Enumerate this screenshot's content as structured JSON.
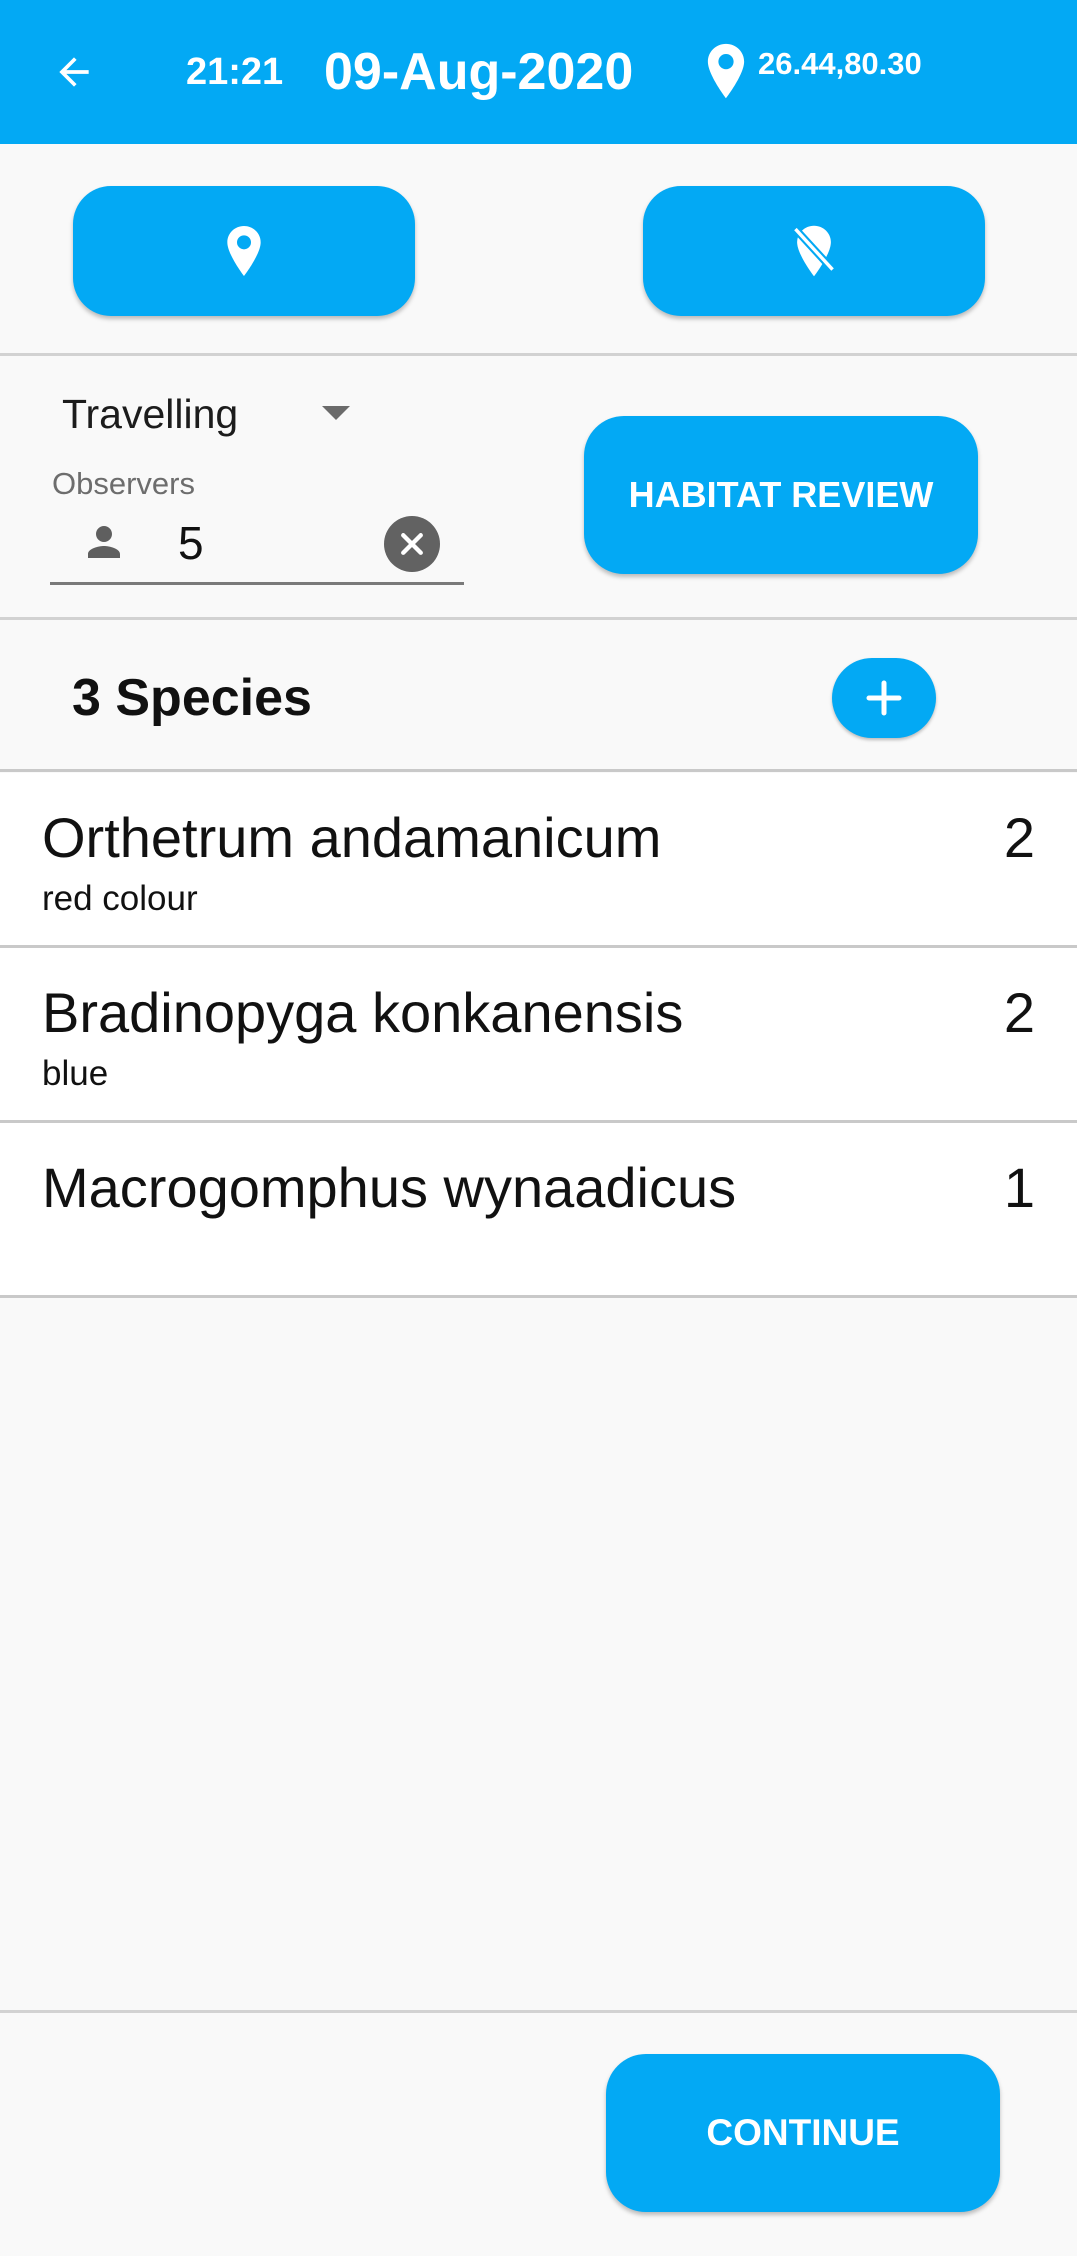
{
  "header": {
    "time": "21:21",
    "date": "09-Aug-2020",
    "coords": "26.44,80.30",
    "back_icon": "arrow-left-icon",
    "location_icon": "map-pin-icon",
    "color": "#03a9f4"
  },
  "location_buttons": {
    "set_icon": "map-pin-icon",
    "clear_icon": "map-pin-off-icon"
  },
  "survey": {
    "mode": "Travelling",
    "observers_label": "Observers",
    "observers_value": "5",
    "habitat_label": "HABITAT REVIEW"
  },
  "species_header": {
    "count_label": "3 Species",
    "add_icon": "plus-icon"
  },
  "species": [
    {
      "name": "Orthetrum andamanicum",
      "note": "red colour",
      "count": "2"
    },
    {
      "name": "Bradinopyga konkanensis",
      "note": "blue",
      "count": "2"
    },
    {
      "name": "Macrogomphus wynaadicus",
      "note": "",
      "count": "1"
    }
  ],
  "footer": {
    "continue_label": "CONTINUE"
  }
}
